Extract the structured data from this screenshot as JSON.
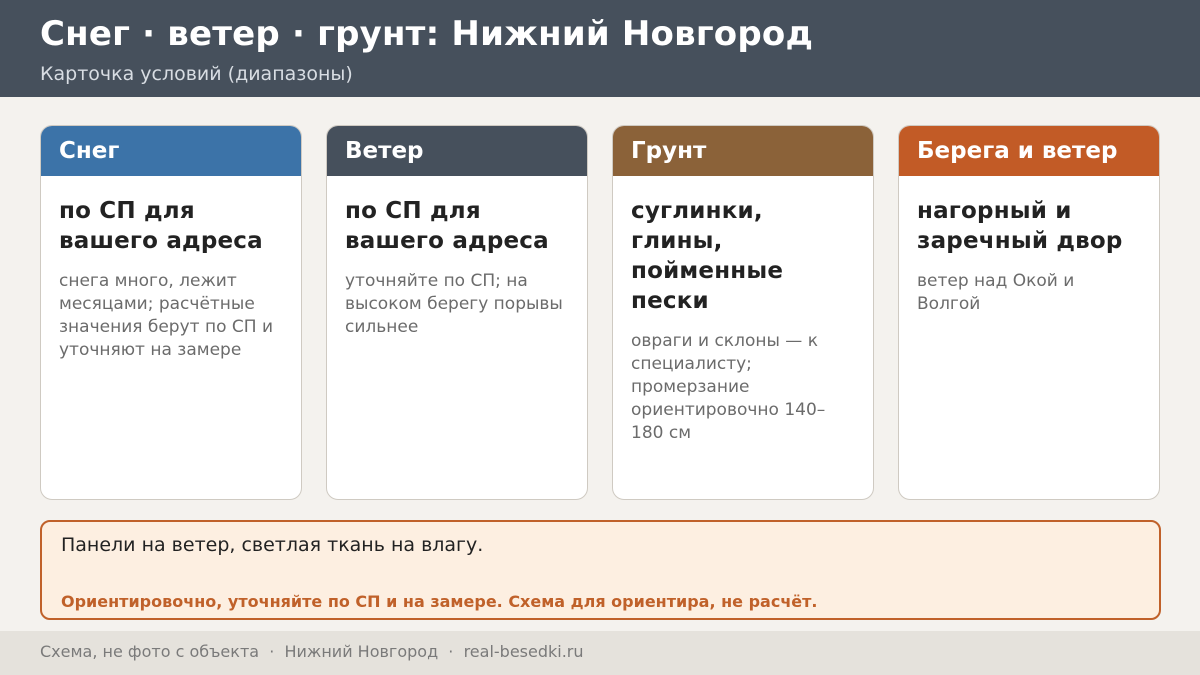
{
  "header": {
    "title": "Снег · ветер · грунт: Нижний Новгород",
    "subtitle": "Карточка условий (диапазоны)"
  },
  "cards": [
    {
      "title": "Снег",
      "color": "#3c73a8",
      "main": "по СП для вашего адреса",
      "note": "снега много, лежит месяцами; расчётные значения берут по СП и уточняют на замере"
    },
    {
      "title": "Ветер",
      "color": "#46505c",
      "main": "по СП для вашего адреса",
      "note": "уточняйте по СП; на высоком берегу порывы сильнее"
    },
    {
      "title": "Грунт",
      "color": "#8b6239",
      "main": "суглинки, глины, пойменные пески",
      "note": "овраги и склоны — к специалисту; промерзание ориентировочно 140–180 см"
    },
    {
      "title": "Берега и ветер",
      "color": "#c25b26",
      "main": "нагорный и заречный двор",
      "note": "ветер над Окой и Волгой"
    }
  ],
  "notice": {
    "main": "Панели на ветер, светлая ткань на влагу.",
    "warning": "Ориентировочно, уточняйте по СП и на замере. Схема для ориентира, не расчёт.",
    "accent_color": "#c0612a"
  },
  "footer": {
    "text": "Схема, не фото с объекта  ·  Нижний Новгород  ·  real-besedki.ru"
  }
}
